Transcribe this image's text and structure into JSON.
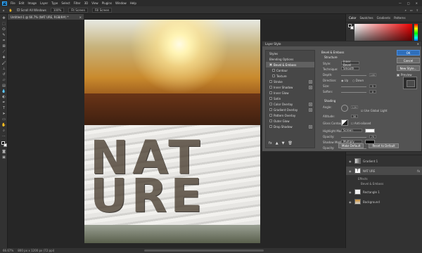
{
  "menubar": {
    "logo": "Ps",
    "items": [
      "File",
      "Edit",
      "Image",
      "Layer",
      "Type",
      "Select",
      "Filter",
      "3D",
      "View",
      "Plugins",
      "Window",
      "Help"
    ],
    "window_controls": [
      "—",
      "□",
      "✕"
    ]
  },
  "options": {
    "home_icon": "home-icon",
    "tool_icon": "hand-icon",
    "scroll_all": "Scroll All Windows",
    "zoom": "100%",
    "fit_screen": "Fit Screen",
    "fill_screen": "Fill Screen"
  },
  "document": {
    "tab": "Untitled-1 @ 66.7% (NAT URE, RGB/8#) *",
    "close": "×"
  },
  "canvas": {
    "text_line1": "NAT",
    "text_line2": "URE"
  },
  "status": {
    "zoom": "66.67%",
    "info": "800 px x 1200 px (72 ppi)"
  },
  "right": {
    "tabs": [
      "Color",
      "Swatches",
      "Gradients",
      "Patterns"
    ],
    "layers": [
      {
        "name": "Gradient 1",
        "selected": false
      },
      {
        "name": "NAT URE",
        "selected": true
      },
      {
        "name": "Effects",
        "sub": true
      },
      {
        "name": "Bevel & Emboss",
        "sub": true
      },
      {
        "name": "Rectangle 1",
        "selected": false
      },
      {
        "name": "Background",
        "selected": false
      }
    ]
  },
  "dialog": {
    "title": "Layer Style",
    "close": "✕",
    "left_header": "Styles",
    "left_items": [
      {
        "label": "Blending Options",
        "check": false,
        "plus": false,
        "sel": false
      },
      {
        "label": "Bevel & Emboss",
        "check": true,
        "plus": false,
        "sel": true
      },
      {
        "label": "Contour",
        "check": false,
        "plus": false,
        "sel": false,
        "indent": true
      },
      {
        "label": "Texture",
        "check": false,
        "plus": false,
        "sel": false,
        "indent": true
      },
      {
        "label": "Stroke",
        "check": false,
        "plus": true,
        "sel": false
      },
      {
        "label": "Inner Shadow",
        "check": false,
        "plus": true,
        "sel": false
      },
      {
        "label": "Inner Glow",
        "check": false,
        "plus": false,
        "sel": false
      },
      {
        "label": "Satin",
        "check": false,
        "plus": false,
        "sel": false
      },
      {
        "label": "Color Overlay",
        "check": false,
        "plus": true,
        "sel": false
      },
      {
        "label": "Gradient Overlay",
        "check": false,
        "plus": true,
        "sel": false
      },
      {
        "label": "Pattern Overlay",
        "check": false,
        "plus": false,
        "sel": false
      },
      {
        "label": "Outer Glow",
        "check": false,
        "plus": false,
        "sel": false
      },
      {
        "label": "Drop Shadow",
        "check": false,
        "plus": true,
        "sel": false
      }
    ],
    "bottom_icons": [
      "fx",
      "▲",
      "▼",
      "🗑"
    ],
    "section_title": "Bevel & Emboss",
    "structure": "Structure",
    "style_label": "Style:",
    "style_value": "Inner Bevel",
    "technique_label": "Technique:",
    "technique_value": "Smooth",
    "depth_label": "Depth:",
    "depth_value": "100",
    "direction_label": "Direction:",
    "up": "Up",
    "down": "Down",
    "size_label": "Size:",
    "size_value": "5",
    "soften_label": "Soften:",
    "soften_value": "0",
    "shading": "Shading",
    "angle_label": "Angle:",
    "angle_value": "120",
    "global_light": "Use Global Light",
    "altitude_label": "Altitude:",
    "altitude_value": "30",
    "gloss_label": "Gloss Contour:",
    "anti_aliased": "Anti-aliased",
    "highlight_label": "Highlight Mode:",
    "highlight_value": "Screen",
    "opacity_label": "Opacity:",
    "opacity1_value": "75",
    "shadow_label": "Shadow Mode:",
    "shadow_value": "Multiply",
    "opacity2_value": "75",
    "make_default": "Make Default",
    "reset_default": "Reset to Default",
    "ok": "OK",
    "cancel": "Cancel",
    "new_style": "New Style...",
    "preview": "Preview"
  }
}
